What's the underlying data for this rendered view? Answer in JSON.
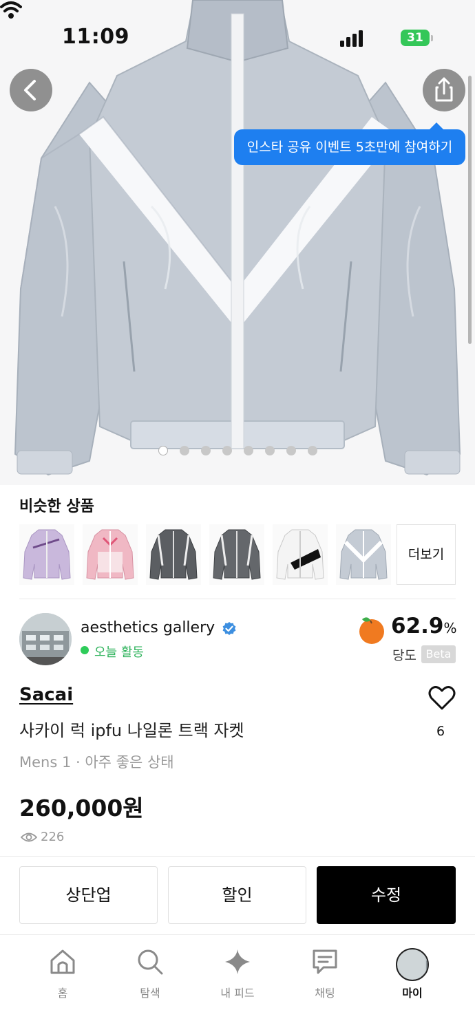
{
  "status_bar": {
    "time": "11:09",
    "battery": "31"
  },
  "tooltip": {
    "text": "인스타 공유 이벤트 5초만에 참여하기"
  },
  "carousel": {
    "total_images": 8,
    "active_index": 0
  },
  "similar": {
    "title": "비슷한 상품",
    "more_label": "더보기",
    "items": [
      {
        "icon": "lavender-jacket-thumbnail"
      },
      {
        "icon": "pink-jacket-thumbnail"
      },
      {
        "icon": "grey-jacket-thumbnail"
      },
      {
        "icon": "grey-jacket-thumbnail-2"
      },
      {
        "icon": "white-black-jacket-thumbnail"
      },
      {
        "icon": "clear-grey-jacket-thumbnail"
      }
    ]
  },
  "seller": {
    "name": "aesthetics gallery",
    "activity": "오늘 활동",
    "score": "62.9",
    "score_unit": "%",
    "score_label": "당도",
    "beta": "Beta"
  },
  "product": {
    "brand": "Sacai",
    "title": "사카이 럭 ipfu 나일론 트랙 자켓",
    "meta": "Mens 1 · 아주 좋은 상태",
    "price": "260,000원",
    "views": "226",
    "likes": "6"
  },
  "actions": {
    "bump": "상단업",
    "discount": "할인",
    "edit": "수정"
  },
  "tabs": [
    {
      "label": "홈",
      "icon": "home-icon"
    },
    {
      "label": "탐색",
      "icon": "search-icon"
    },
    {
      "label": "내 피드",
      "icon": "sparkle-icon"
    },
    {
      "label": "채팅",
      "icon": "chat-icon"
    },
    {
      "label": "마이",
      "icon": "avatar"
    }
  ],
  "colors": {
    "accent": "#1e7ff0",
    "active_green": "#2fb35c",
    "peach": "#f07a20"
  }
}
